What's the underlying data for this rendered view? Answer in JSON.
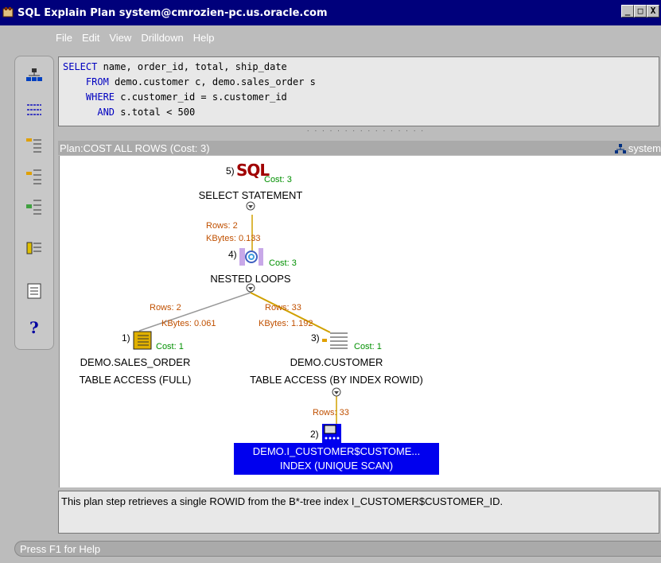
{
  "window": {
    "title": "SQL Explain Plan system@cmrozien-pc.us.oracle.com",
    "min": "_",
    "max": "□",
    "close": "X"
  },
  "menu": [
    "File",
    "Edit",
    "View",
    "Drilldown",
    "Help"
  ],
  "sql": {
    "line1_kw": "SELECT",
    "line1_rest": " name, order_id, total, ship_date",
    "line2_kw": "FROM",
    "line2_rest": " demo.customer c, demo.sales_order s",
    "line3_kw": "WHERE",
    "line3_rest": " c.customer_id = s.customer_id",
    "line4_kw": "AND",
    "line4_rest": " s.total < 500"
  },
  "plan": {
    "header": "Plan:COST ALL ROWS (Cost: 3)",
    "connection": "system",
    "nodes": {
      "n5": {
        "num": "5)",
        "sql_logo": "SQL",
        "cost": "Cost: 3",
        "label": "SELECT STATEMENT"
      },
      "n4": {
        "num": "4)",
        "cost": "Cost: 3",
        "label": "NESTED LOOPS"
      },
      "n1": {
        "num": "1)",
        "cost": "Cost: 1",
        "label1": "DEMO.SALES_ORDER",
        "label2": "TABLE ACCESS (FULL)"
      },
      "n3": {
        "num": "3)",
        "cost": "Cost: 1",
        "label1": "DEMO.CUSTOMER",
        "label2": "TABLE ACCESS (BY INDEX ROWID)"
      },
      "n2": {
        "num": "2)",
        "label1": "DEMO.I_CUSTOMER$CUSTOME...",
        "label2": "INDEX (UNIQUE SCAN)"
      }
    },
    "edges": {
      "e54_rows": "Rows: 2",
      "e54_kb": "KBytes: 0.133",
      "e41_rows": "Rows: 2",
      "e41_kb": "KBytes: 0.061",
      "e43_rows": "Rows: 33",
      "e43_kb": "KBytes: 1.192",
      "e32_rows": "Rows: 33"
    }
  },
  "description": "This plan step retrieves a single ROWID from the B*-tree index I_CUSTOMER$CUSTOMER_ID.",
  "status": "Press F1 for Help",
  "icons": [
    "tree-view-icon",
    "list-view-icon",
    "step-in-icon",
    "step-out-icon",
    "step-prev-icon",
    "summary-icon",
    "report-icon",
    "help-icon"
  ]
}
